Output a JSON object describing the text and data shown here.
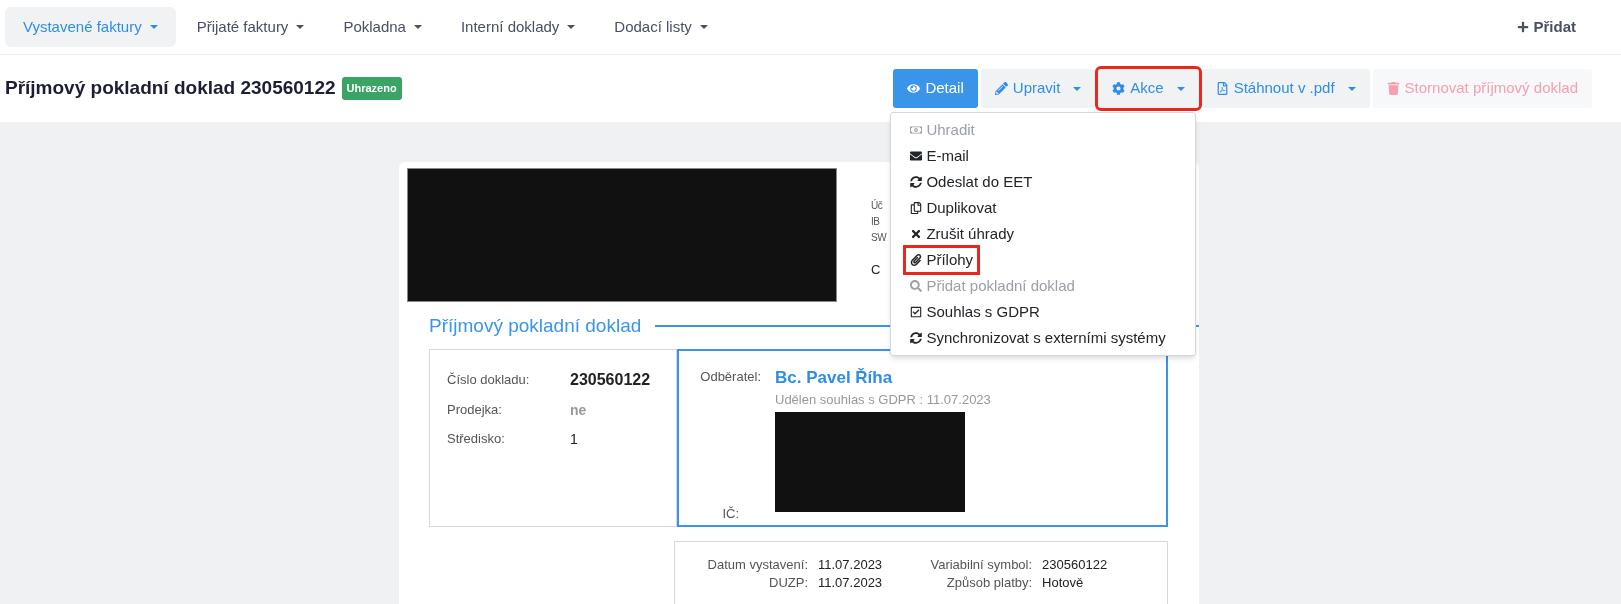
{
  "nav": {
    "items": [
      {
        "label": "Vystavené faktury",
        "selected": true
      },
      {
        "label": "Přijaté faktury",
        "selected": false
      },
      {
        "label": "Pokladna",
        "selected": false
      },
      {
        "label": "Interní doklady",
        "selected": false
      },
      {
        "label": "Dodací listy",
        "selected": false
      }
    ],
    "add_button": "Přidat"
  },
  "header": {
    "title": "Příjmový pokladní doklad 230560122",
    "badge": "Uhrazeno",
    "buttons": [
      {
        "label": "Detail",
        "kind": "primary",
        "caret": false,
        "highlighted": false
      },
      {
        "label": "Upravit",
        "kind": "default",
        "caret": true,
        "highlighted": false
      },
      {
        "label": "Akce",
        "kind": "default",
        "caret": true,
        "highlighted": true
      },
      {
        "label": "Stáhnout v .pdf",
        "kind": "default",
        "caret": true,
        "highlighted": false
      },
      {
        "label": "Stornovat příjmový doklad",
        "kind": "danger",
        "caret": false,
        "highlighted": false
      }
    ]
  },
  "dropdown": {
    "items": [
      {
        "label": "Uhradit",
        "disabled": true,
        "highlighted": false
      },
      {
        "label": "E-mail",
        "disabled": false,
        "highlighted": false
      },
      {
        "label": "Odeslat do EET",
        "disabled": false,
        "highlighted": false
      },
      {
        "label": "Duplikovat",
        "disabled": false,
        "highlighted": false
      },
      {
        "label": "Zrušit úhrady",
        "disabled": false,
        "highlighted": false
      },
      {
        "label": "Přílohy",
        "disabled": false,
        "highlighted": true
      },
      {
        "label": "Přidat pokladní doklad",
        "disabled": true,
        "highlighted": false
      },
      {
        "label": "Souhlas s GDPR",
        "disabled": false,
        "highlighted": false
      },
      {
        "label": "Synchronizovat s externími systémy",
        "disabled": false,
        "highlighted": false
      }
    ]
  },
  "document": {
    "partial_lines": [
      "Úč",
      "IB",
      "SW",
      "C"
    ],
    "section_title": "Příjmový pokladní doklad",
    "fields": [
      {
        "label": "Číslo dokladu:",
        "value": "230560122",
        "kind": "number"
      },
      {
        "label": "Prodejka:",
        "value": "ne",
        "kind": "muted"
      },
      {
        "label": "Středisko:",
        "value": "1",
        "kind": "plain"
      }
    ],
    "customer": {
      "label": "Odběratel:",
      "name": "Bc. Pavel Říha",
      "gdpr_note": "Udělen souhlas s GDPR : 11.07.2023",
      "ic_label": "IČ:"
    },
    "dates": [
      {
        "label": "Datum vystavení:",
        "value": "11.07.2023"
      },
      {
        "label": "DUZP:",
        "value": "11.07.2023"
      }
    ],
    "payment": [
      {
        "label": "Variabilní symbol:",
        "value": "230560122"
      },
      {
        "label": "Způsob platby:",
        "value": "Hotově"
      }
    ]
  }
}
